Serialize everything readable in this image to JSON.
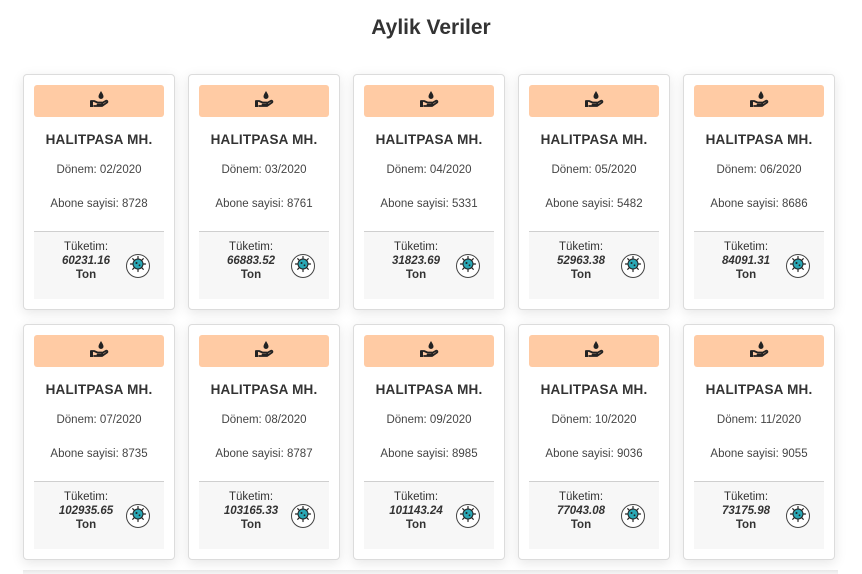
{
  "header": {
    "title": "Aylik Veriler"
  },
  "labels": {
    "period_prefix": "Dönem: ",
    "subs_prefix": "Abone sayisi: ",
    "usage_label": "Tüketim:",
    "unit": "Ton"
  },
  "colors": {
    "card_header": "#ffcba4",
    "virus_icon": "#2aa7b5"
  },
  "icons": {
    "header_icon": "hand-water-drop-icon",
    "action_icon": "virus-icon"
  },
  "cards": [
    {
      "name": "HALITPASA MH.",
      "period": "Dönem: 02/2020",
      "subs": "Abone sayisi: 8728",
      "usage": "60231.16"
    },
    {
      "name": "HALITPASA MH.",
      "period": "Dönem: 03/2020",
      "subs": "Abone sayisi: 8761",
      "usage": "66883.52"
    },
    {
      "name": "HALITPASA MH.",
      "period": "Dönem: 04/2020",
      "subs": "Abone sayisi: 5331",
      "usage": "31823.69"
    },
    {
      "name": "HALITPASA MH.",
      "period": "Dönem: 05/2020",
      "subs": "Abone sayisi: 5482",
      "usage": "52963.38"
    },
    {
      "name": "HALITPASA MH.",
      "period": "Dönem: 06/2020",
      "subs": "Abone sayisi: 8686",
      "usage": "84091.31"
    },
    {
      "name": "HALITPASA MH.",
      "period": "Dönem: 07/2020",
      "subs": "Abone sayisi: 8735",
      "usage": "102935.65"
    },
    {
      "name": "HALITPASA MH.",
      "period": "Dönem: 08/2020",
      "subs": "Abone sayisi: 8787",
      "usage": "103165.33"
    },
    {
      "name": "HALITPASA MH.",
      "period": "Dönem: 09/2020",
      "subs": "Abone sayisi: 8985",
      "usage": "101143.24"
    },
    {
      "name": "HALITPASA MH.",
      "period": "Dönem: 10/2020",
      "subs": "Abone sayisi: 9036",
      "usage": "77043.08"
    },
    {
      "name": "HALITPASA MH.",
      "period": "Dönem: 11/2020",
      "subs": "Abone sayisi: 9055",
      "usage": "73175.98"
    }
  ]
}
